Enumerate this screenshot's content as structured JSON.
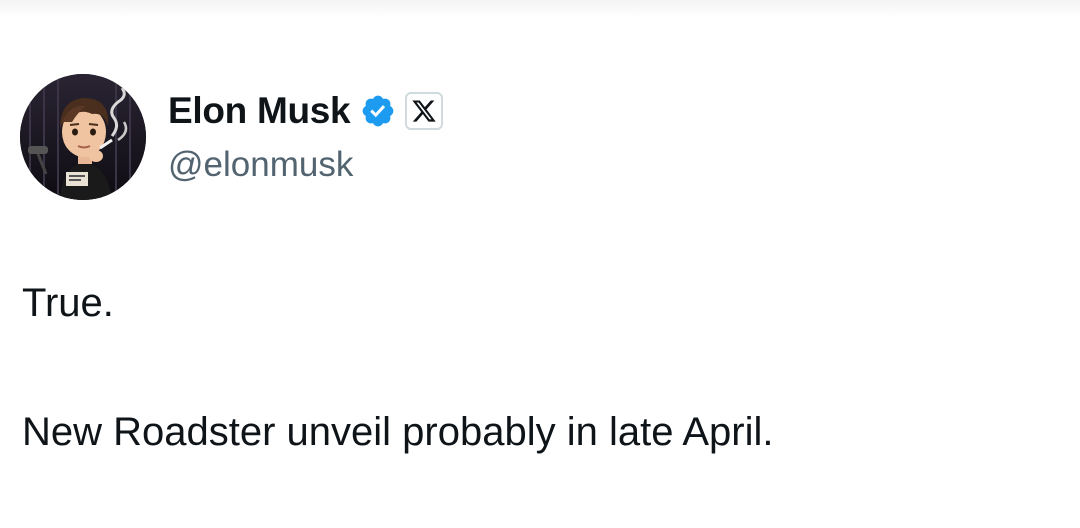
{
  "tweet": {
    "author": {
      "display_name": "Elon Musk",
      "handle": "@elonmusk",
      "verified_badge_icon": "verified-checkmark-icon",
      "affiliation_icon": "x-logo-icon"
    },
    "text_lines": [
      "True.",
      "New Roadster unveil probably in late April."
    ]
  },
  "colors": {
    "text_primary": "#0f1419",
    "text_secondary": "#536471",
    "verified_blue": "#1d9bf0",
    "background": "#ffffff"
  }
}
